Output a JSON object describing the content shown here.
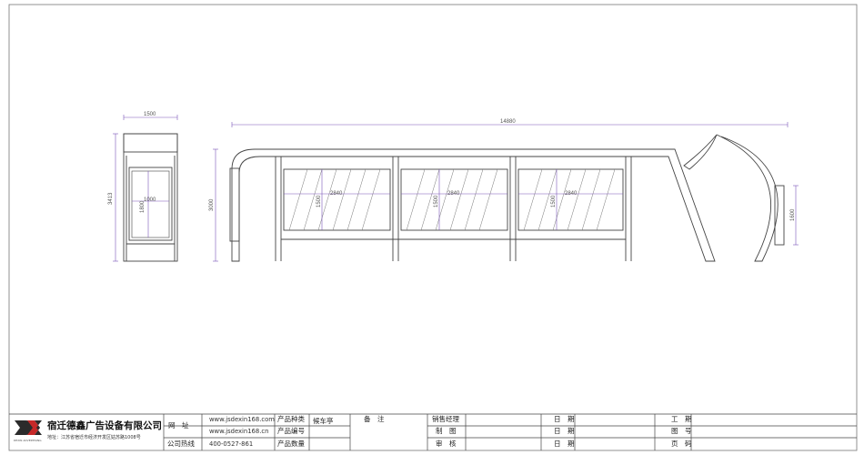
{
  "drawing": {
    "side_view": {
      "width_label": "1500",
      "height_label": "3413",
      "panel_width_label": "1000",
      "panel_height_label": "1800"
    },
    "front_view": {
      "total_length_label": "14880",
      "height_label": "3000",
      "panels": [
        {
          "width_label": "2840",
          "height_label": "1500"
        },
        {
          "width_label": "2840",
          "height_label": "1500"
        },
        {
          "width_label": "2840",
          "height_label": "1500"
        }
      ],
      "end_panel_height_label": "1600"
    }
  },
  "title_block": {
    "company_name": "宿迁德鑫广告设备有限公司",
    "address": "地址：江苏省宿迁市经济开发区姑苏路1008号",
    "logo_letters": "DX",
    "logo_subtitle": "DEXIN ADVERTISING",
    "website_label": "网　址",
    "website_1": "www.jsdexin168.com",
    "website_2": "www.jsdexin168.cn",
    "hotline_label": "公司热线",
    "hotline": "400-0527-861",
    "product_type_label": "产品种类",
    "product_type_value": "候车亭",
    "product_code_label": "产品编号",
    "product_qty_label": "产品数量",
    "remarks_label": "备　注",
    "sales_manager_label": "销售经理",
    "drafting_label": "制　图",
    "review_label": "审　核",
    "date_label": "日　期",
    "work_period_label": "工　期",
    "drawing_no_label": "图　号",
    "page_no_label": "页　码"
  }
}
